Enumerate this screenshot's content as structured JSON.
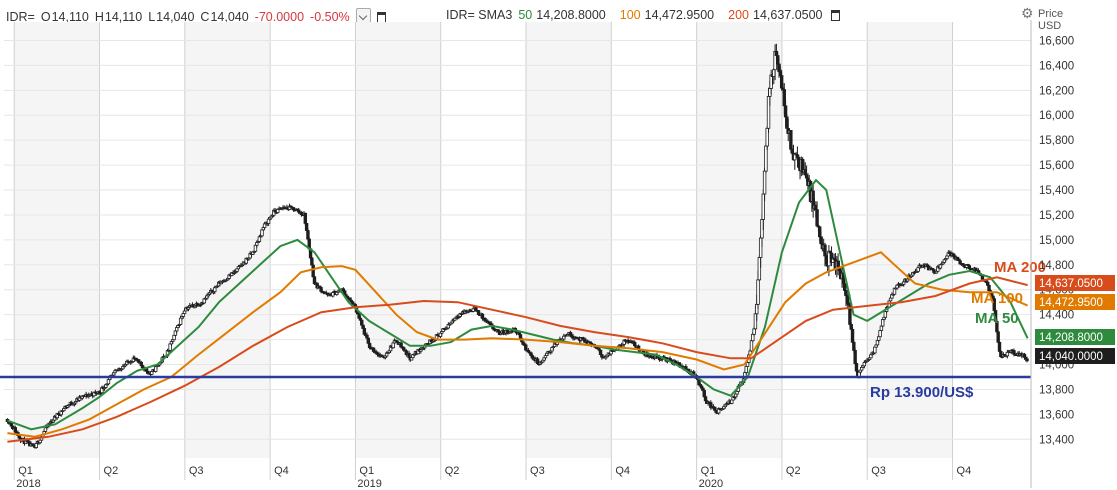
{
  "header": {
    "quote_symbol": "IDR=",
    "open_label": "O",
    "open": "14,110",
    "high_label": "H",
    "high": "14,110",
    "low_label": "L",
    "low": "14,040",
    "close_label": "C",
    "close": "14,040",
    "change": "-70.0000",
    "change_pct": "-0.50%",
    "sma_symbol": "IDR= SMA3",
    "sma50_period": "50",
    "sma50_value": "14,208.8000",
    "sma100_period": "100",
    "sma100_value": "14,472.9500",
    "sma200_period": "200",
    "sma200_value": "14,637.0500",
    "settings_icon": "gear-icon",
    "delete_icon": "trash-icon",
    "dropdown_icon": "chevron-down-icon"
  },
  "colors": {
    "candles": "#1e1e1e",
    "ma50": "#2e8b3e",
    "ma100": "#e07b00",
    "ma200": "#d84c1c",
    "support_line": "#2a3ba0",
    "grid": "#e6e6e6",
    "alt_band": "#f5f5f5"
  },
  "chart_data": {
    "type": "candlestick",
    "y_axis": {
      "title": "Price",
      "unit": "USD",
      "ylim": [
        13250,
        16700
      ],
      "ticks": [
        13400,
        13600,
        13800,
        14000,
        14200,
        14400,
        14600,
        14800,
        15000,
        15200,
        15400,
        15600,
        15800,
        16000,
        16200,
        16400,
        16600
      ],
      "tick_labels": [
        "13,400",
        "13,600",
        "13,800",
        "14,000",
        "14,200",
        "14,400",
        "14,600",
        "14,800",
        "15,000",
        "15,200",
        "15,400",
        "15,600",
        "15,800",
        "16,000",
        "16,200",
        "16,400",
        "16,600"
      ]
    },
    "x_axis": {
      "quarters": [
        "Q1",
        "Q2",
        "Q3",
        "Q4",
        "Q1",
        "Q2",
        "Q3",
        "Q4",
        "Q1",
        "Q2",
        "Q3",
        "Q4"
      ],
      "years": [
        "2018",
        "2019",
        "2020"
      ],
      "xlim": [
        2017.97,
        2020.98
      ]
    },
    "horizontal_line": {
      "value": 13900,
      "label": "Rp 13.900/US$"
    },
    "annotations": [
      {
        "text": "MA 200",
        "series": "ma200"
      },
      {
        "text": "MA 100",
        "series": "ma100"
      },
      {
        "text": "MA 50",
        "series": "ma50"
      }
    ],
    "last_value_tags": [
      {
        "series": "ma200",
        "value": "14,637.0500"
      },
      {
        "series": "ma100",
        "value": "14,472.9500"
      },
      {
        "series": "ma50",
        "value": "14,208.8000"
      },
      {
        "series": "close",
        "value": "14,040.0000"
      }
    ],
    "price_path": [
      [
        2017.98,
        13560
      ],
      [
        2018.02,
        13400
      ],
      [
        2018.06,
        13330
      ],
      [
        2018.1,
        13520
      ],
      [
        2018.15,
        13660
      ],
      [
        2018.2,
        13740
      ],
      [
        2018.25,
        13780
      ],
      [
        2018.3,
        13950
      ],
      [
        2018.35,
        14050
      ],
      [
        2018.4,
        13920
      ],
      [
        2018.45,
        14100
      ],
      [
        2018.5,
        14450
      ],
      [
        2018.55,
        14500
      ],
      [
        2018.6,
        14650
      ],
      [
        2018.65,
        14750
      ],
      [
        2018.7,
        14900
      ],
      [
        2018.73,
        15100
      ],
      [
        2018.76,
        15220
      ],
      [
        2018.79,
        15260
      ],
      [
        2018.82,
        15250
      ],
      [
        2018.85,
        15200
      ],
      [
        2018.88,
        14650
      ],
      [
        2018.92,
        14550
      ],
      [
        2018.96,
        14600
      ],
      [
        2019.0,
        14450
      ],
      [
        2019.04,
        14150
      ],
      [
        2019.08,
        14050
      ],
      [
        2019.12,
        14200
      ],
      [
        2019.16,
        14050
      ],
      [
        2019.2,
        14150
      ],
      [
        2019.25,
        14250
      ],
      [
        2019.3,
        14400
      ],
      [
        2019.35,
        14450
      ],
      [
        2019.38,
        14350
      ],
      [
        2019.42,
        14250
      ],
      [
        2019.47,
        14280
      ],
      [
        2019.5,
        14120
      ],
      [
        2019.54,
        14000
      ],
      [
        2019.58,
        14150
      ],
      [
        2019.62,
        14250
      ],
      [
        2019.66,
        14200
      ],
      [
        2019.7,
        14150
      ],
      [
        2019.73,
        14050
      ],
      [
        2019.77,
        14150
      ],
      [
        2019.8,
        14200
      ],
      [
        2019.85,
        14080
      ],
      [
        2019.9,
        14050
      ],
      [
        2019.95,
        14000
      ],
      [
        2020.0,
        13900
      ],
      [
        2020.03,
        13700
      ],
      [
        2020.06,
        13620
      ],
      [
        2020.1,
        13700
      ],
      [
        2020.14,
        13900
      ],
      [
        2020.17,
        14300
      ],
      [
        2020.19,
        15100
      ],
      [
        2020.21,
        16100
      ],
      [
        2020.23,
        16500
      ],
      [
        2020.25,
        16200
      ],
      [
        2020.28,
        15700
      ],
      [
        2020.31,
        15600
      ],
      [
        2020.34,
        15300
      ],
      [
        2020.37,
        14900
      ],
      [
        2020.4,
        14800
      ],
      [
        2020.43,
        14700
      ],
      [
        2020.45,
        14350
      ],
      [
        2020.47,
        13900
      ],
      [
        2020.49,
        14000
      ],
      [
        2020.52,
        14100
      ],
      [
        2020.55,
        14400
      ],
      [
        2020.58,
        14600
      ],
      [
        2020.62,
        14700
      ],
      [
        2020.66,
        14800
      ],
      [
        2020.7,
        14750
      ],
      [
        2020.74,
        14900
      ],
      [
        2020.78,
        14800
      ],
      [
        2020.82,
        14750
      ],
      [
        2020.85,
        14650
      ],
      [
        2020.87,
        14500
      ],
      [
        2020.89,
        14050
      ],
      [
        2020.92,
        14100
      ],
      [
        2020.95,
        14080
      ],
      [
        2020.97,
        14040
      ]
    ],
    "series": [
      {
        "key": "ma50",
        "values": [
          [
            2017.98,
            13550
          ],
          [
            2018.05,
            13480
          ],
          [
            2018.12,
            13520
          ],
          [
            2018.2,
            13650
          ],
          [
            2018.25,
            13740
          ],
          [
            2018.3,
            13850
          ],
          [
            2018.36,
            13950
          ],
          [
            2018.42,
            14000
          ],
          [
            2018.48,
            14150
          ],
          [
            2018.54,
            14300
          ],
          [
            2018.6,
            14500
          ],
          [
            2018.66,
            14650
          ],
          [
            2018.72,
            14800
          ],
          [
            2018.78,
            14950
          ],
          [
            2018.83,
            15000
          ],
          [
            2018.88,
            14900
          ],
          [
            2018.93,
            14700
          ],
          [
            2018.98,
            14500
          ],
          [
            2019.04,
            14350
          ],
          [
            2019.1,
            14250
          ],
          [
            2019.16,
            14150
          ],
          [
            2019.22,
            14150
          ],
          [
            2019.28,
            14180
          ],
          [
            2019.34,
            14280
          ],
          [
            2019.4,
            14310
          ],
          [
            2019.46,
            14280
          ],
          [
            2019.52,
            14240
          ],
          [
            2019.58,
            14200
          ],
          [
            2019.64,
            14170
          ],
          [
            2019.7,
            14150
          ],
          [
            2019.76,
            14120
          ],
          [
            2019.82,
            14100
          ],
          [
            2019.88,
            14080
          ],
          [
            2019.94,
            14000
          ],
          [
            2020.0,
            13900
          ],
          [
            2020.05,
            13800
          ],
          [
            2020.1,
            13750
          ],
          [
            2020.15,
            13900
          ],
          [
            2020.2,
            14300
          ],
          [
            2020.25,
            14900
          ],
          [
            2020.3,
            15300
          ],
          [
            2020.35,
            15480
          ],
          [
            2020.38,
            15400
          ],
          [
            2020.42,
            14900
          ],
          [
            2020.46,
            14400
          ],
          [
            2020.5,
            14350
          ],
          [
            2020.56,
            14450
          ],
          [
            2020.62,
            14550
          ],
          [
            2020.68,
            14650
          ],
          [
            2020.74,
            14720
          ],
          [
            2020.8,
            14750
          ],
          [
            2020.86,
            14700
          ],
          [
            2020.92,
            14500
          ],
          [
            2020.97,
            14210
          ]
        ]
      },
      {
        "key": "ma100",
        "values": [
          [
            2017.98,
            13450
          ],
          [
            2018.06,
            13420
          ],
          [
            2018.14,
            13480
          ],
          [
            2018.22,
            13560
          ],
          [
            2018.3,
            13680
          ],
          [
            2018.38,
            13800
          ],
          [
            2018.46,
            13900
          ],
          [
            2018.54,
            14080
          ],
          [
            2018.62,
            14250
          ],
          [
            2018.7,
            14420
          ],
          [
            2018.78,
            14580
          ],
          [
            2018.84,
            14740
          ],
          [
            2018.9,
            14780
          ],
          [
            2018.96,
            14790
          ],
          [
            2019.0,
            14760
          ],
          [
            2019.06,
            14580
          ],
          [
            2019.12,
            14400
          ],
          [
            2019.18,
            14260
          ],
          [
            2019.24,
            14200
          ],
          [
            2019.32,
            14200
          ],
          [
            2019.4,
            14210
          ],
          [
            2019.5,
            14200
          ],
          [
            2019.6,
            14180
          ],
          [
            2019.7,
            14150
          ],
          [
            2019.8,
            14130
          ],
          [
            2019.9,
            14100
          ],
          [
            2020.0,
            14040
          ],
          [
            2020.08,
            13960
          ],
          [
            2020.14,
            14000
          ],
          [
            2020.2,
            14250
          ],
          [
            2020.26,
            14500
          ],
          [
            2020.32,
            14650
          ],
          [
            2020.38,
            14740
          ],
          [
            2020.44,
            14800
          ],
          [
            2020.5,
            14860
          ],
          [
            2020.54,
            14900
          ],
          [
            2020.58,
            14800
          ],
          [
            2020.64,
            14650
          ],
          [
            2020.72,
            14600
          ],
          [
            2020.8,
            14580
          ],
          [
            2020.88,
            14580
          ],
          [
            2020.97,
            14473
          ]
        ]
      },
      {
        "key": "ma200",
        "values": [
          [
            2017.98,
            13380
          ],
          [
            2018.1,
            13420
          ],
          [
            2018.2,
            13480
          ],
          [
            2018.3,
            13580
          ],
          [
            2018.4,
            13700
          ],
          [
            2018.5,
            13830
          ],
          [
            2018.6,
            13980
          ],
          [
            2018.7,
            14150
          ],
          [
            2018.8,
            14300
          ],
          [
            2018.9,
            14420
          ],
          [
            2019.0,
            14460
          ],
          [
            2019.1,
            14480
          ],
          [
            2019.2,
            14510
          ],
          [
            2019.3,
            14500
          ],
          [
            2019.4,
            14440
          ],
          [
            2019.5,
            14380
          ],
          [
            2019.6,
            14310
          ],
          [
            2019.7,
            14260
          ],
          [
            2019.8,
            14220
          ],
          [
            2019.9,
            14170
          ],
          [
            2020.0,
            14100
          ],
          [
            2020.1,
            14050
          ],
          [
            2020.16,
            14050
          ],
          [
            2020.24,
            14200
          ],
          [
            2020.32,
            14350
          ],
          [
            2020.4,
            14440
          ],
          [
            2020.5,
            14470
          ],
          [
            2020.6,
            14500
          ],
          [
            2020.7,
            14550
          ],
          [
            2020.8,
            14650
          ],
          [
            2020.88,
            14700
          ],
          [
            2020.97,
            14637
          ]
        ]
      }
    ]
  }
}
